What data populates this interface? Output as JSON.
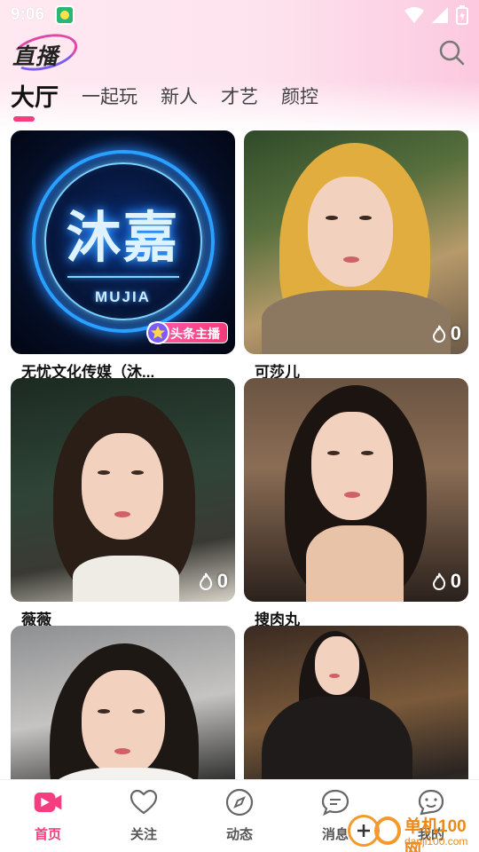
{
  "status_bar": {
    "time": "9:06"
  },
  "header": {
    "logo_text": "直播"
  },
  "tabs": [
    {
      "label": "大厅",
      "active": true
    },
    {
      "label": "一起玩",
      "active": false
    },
    {
      "label": "新人",
      "active": false
    },
    {
      "label": "才艺",
      "active": false
    },
    {
      "label": "颜控",
      "active": false
    }
  ],
  "cards": [
    {
      "name": "无忧文化传媒（沐...",
      "overlay_title": "沐嘉",
      "overlay_sub": "MUJIA",
      "badge": "头条主播"
    },
    {
      "name": "可莎儿",
      "heat": "0"
    },
    {
      "name": "薇薇",
      "heat": "0"
    },
    {
      "name": "搜肉丸",
      "heat": "0"
    },
    {
      "name": ""
    },
    {
      "name": ""
    }
  ],
  "bottom_nav": [
    {
      "label": "首页",
      "icon": "live-video-icon",
      "active": true
    },
    {
      "label": "关注",
      "icon": "heart-icon",
      "active": false
    },
    {
      "label": "动态",
      "icon": "compass-icon",
      "active": false
    },
    {
      "label": "消息",
      "icon": "chat-bubble-icon",
      "active": false
    },
    {
      "label": "我的",
      "icon": "smiley-icon",
      "active": false
    }
  ],
  "watermark": {
    "text": "单机100网",
    "sub": "danji100.com"
  },
  "colors": {
    "accent": "#f53e7f",
    "heat_icon": "#ffffff"
  }
}
